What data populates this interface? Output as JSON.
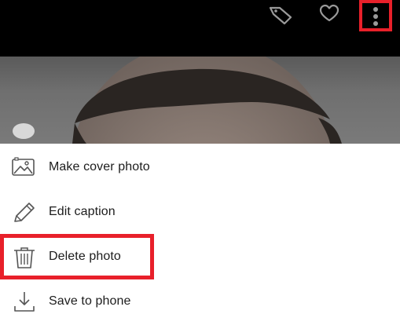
{
  "toolbar": {
    "icons": [
      "tag-icon",
      "heart-icon",
      "more-vertical-icon"
    ],
    "highlight_color": "#e8202a"
  },
  "menu": {
    "items": [
      {
        "label": "Make cover photo",
        "icon": "image-icon"
      },
      {
        "label": "Edit caption",
        "icon": "pencil-icon"
      },
      {
        "label": "Delete photo",
        "icon": "trash-icon"
      },
      {
        "label": "Save to phone",
        "icon": "download-icon"
      }
    ]
  }
}
